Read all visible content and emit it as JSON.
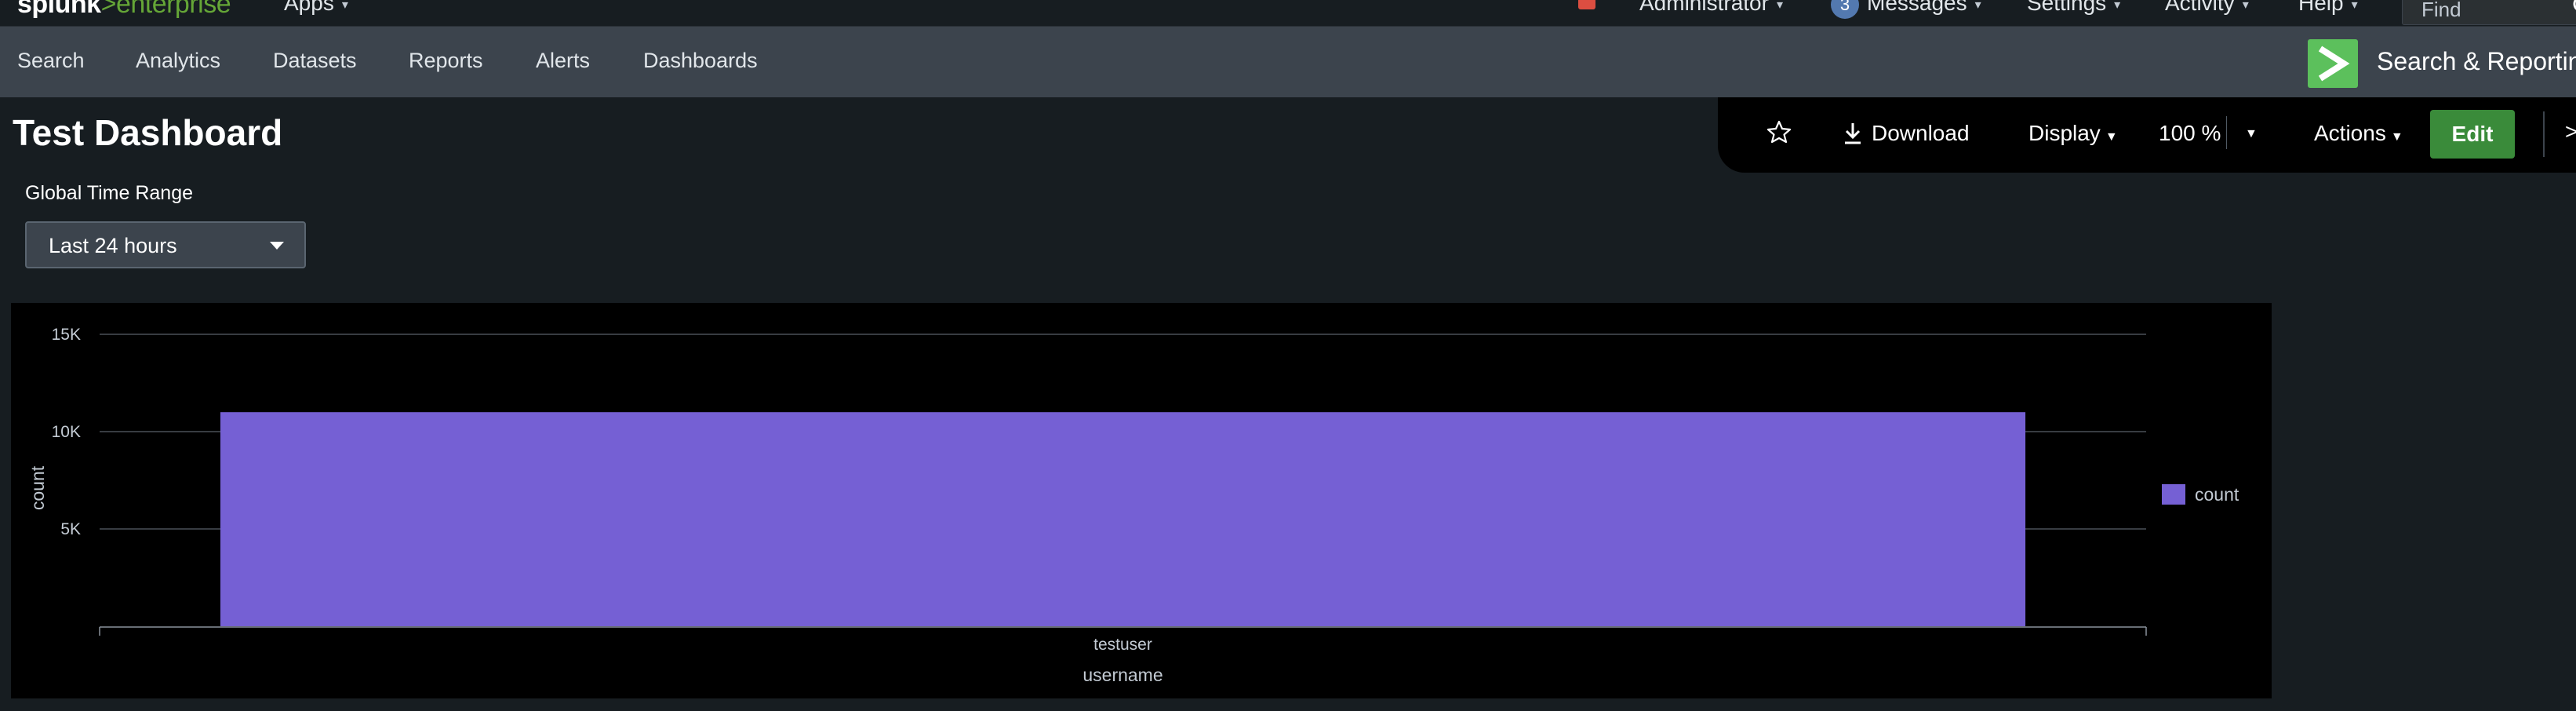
{
  "topbar": {
    "logo_splunk": "splunk",
    "logo_gt": ">",
    "logo_enterprise": "enterprise",
    "apps_label": "Apps",
    "administrator_label": "Administrator",
    "messages_count": "3",
    "messages_label": "Messages",
    "settings_label": "Settings",
    "activity_label": "Activity",
    "help_label": "Help",
    "find_placeholder": "Find"
  },
  "appbar": {
    "nav": [
      "Search",
      "Analytics",
      "Datasets",
      "Reports",
      "Alerts",
      "Dashboards"
    ],
    "app_name": "Search & Reportin"
  },
  "dashboard": {
    "title": "Test Dashboard"
  },
  "toolbar": {
    "download_label": "Download",
    "display_label": "Display",
    "zoom_label": "100 %",
    "actions_label": "Actions",
    "edit_label": "Edit",
    "trailing": ">"
  },
  "filters": {
    "time_range_label": "Global Time Range",
    "time_range_value": "Last 24 hours"
  },
  "colors": {
    "accent_green": "#5cc05c",
    "bar_purple": "#7560d4",
    "edit_green": "#3a8b3a"
  },
  "chart_data": {
    "type": "bar",
    "categories": [
      "testuser"
    ],
    "series": [
      {
        "name": "count",
        "values": [
          11000
        ],
        "color": "#7560d4"
      }
    ],
    "xlabel": "username",
    "ylabel": "count",
    "ylim": [
      0,
      15000
    ],
    "yticks": [
      {
        "value": 5000,
        "label": "5K"
      },
      {
        "value": 10000,
        "label": "10K"
      },
      {
        "value": 15000,
        "label": "15K"
      }
    ],
    "grid": true,
    "legend": "right"
  }
}
